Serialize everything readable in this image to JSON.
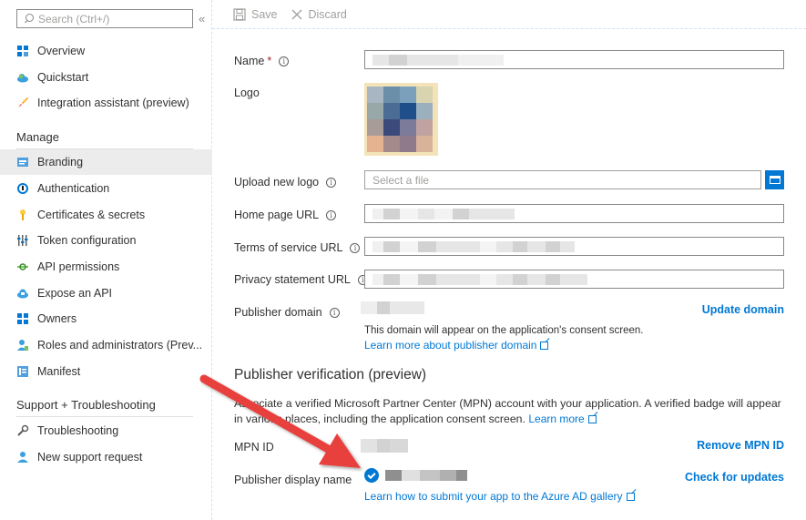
{
  "sidebar": {
    "search_placeholder": "Search (Ctrl+/)",
    "collapse_glyph": "«",
    "items_top": [
      {
        "label": "Overview",
        "icon": "overview-icon"
      },
      {
        "label": "Quickstart",
        "icon": "quickstart-cloud-icon"
      },
      {
        "label": "Integration assistant (preview)",
        "icon": "rocket-icon"
      }
    ],
    "manage_header": "Manage",
    "items_manage": [
      {
        "label": "Branding",
        "icon": "branding-icon",
        "active": true
      },
      {
        "label": "Authentication",
        "icon": "authentication-icon"
      },
      {
        "label": "Certificates & secrets",
        "icon": "key-icon"
      },
      {
        "label": "Token configuration",
        "icon": "token-bars-icon"
      },
      {
        "label": "API permissions",
        "icon": "api-permissions-icon"
      },
      {
        "label": "Expose an API",
        "icon": "expose-api-cloud-icon"
      },
      {
        "label": "Owners",
        "icon": "owners-grid-icon"
      },
      {
        "label": "Roles and administrators (Prev...",
        "icon": "roles-person-icon"
      },
      {
        "label": "Manifest",
        "icon": "manifest-icon"
      }
    ],
    "support_header": "Support + Troubleshooting",
    "items_support": [
      {
        "label": "Troubleshooting",
        "icon": "wrench-icon"
      },
      {
        "label": "New support request",
        "icon": "support-person-icon"
      }
    ]
  },
  "toolbar": {
    "save_label": "Save",
    "discard_label": "Discard"
  },
  "form": {
    "name_label": "Name",
    "required_mark": "*",
    "logo_label": "Logo",
    "upload_label": "Upload new logo",
    "upload_placeholder": "Select a file",
    "homepage_label": "Home page URL",
    "tos_label": "Terms of service URL",
    "privacy_label": "Privacy statement URL",
    "publisher_domain_label": "Publisher domain",
    "update_domain": "Update domain",
    "domain_note": "This domain will appear on the application's consent screen.",
    "learn_domain": "Learn more about publisher domain"
  },
  "verification": {
    "heading": "Publisher verification (preview)",
    "description": "Associate a verified Microsoft Partner Center (MPN) account with your application. A verified badge will appear in various places, including the application consent screen.",
    "learn_more": "Learn more",
    "mpn_label": "MPN ID",
    "remove_mpn": "Remove MPN ID",
    "display_name_label": "Publisher display name",
    "check_updates": "Check for updates",
    "gallery_link": "Learn how to submit your app to the Azure AD gallery"
  },
  "colors": {
    "accent": "#0078d4",
    "arrow": "#e8413c",
    "active_bg": "#ececec"
  }
}
